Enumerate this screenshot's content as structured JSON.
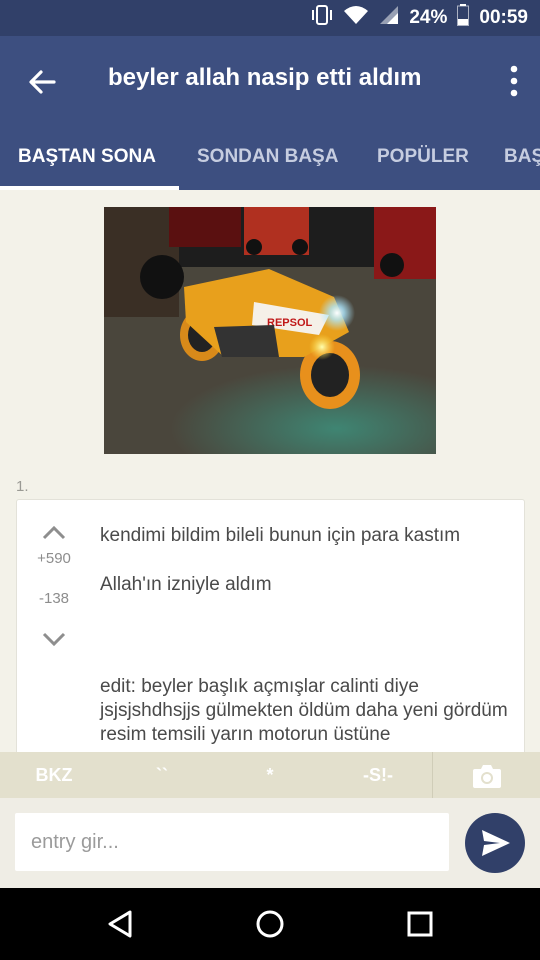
{
  "status_bar": {
    "battery": "24%",
    "time": "00:59",
    "icons": [
      "vibrate-icon",
      "wifi-icon",
      "signal-icon",
      "battery-icon"
    ]
  },
  "header": {
    "title": "beyler allah nasip etti aldım",
    "back_icon": "arrow-back-icon",
    "more_icon": "more-vert-icon"
  },
  "tabs": [
    {
      "label": "BAŞTAN SONA",
      "active": true
    },
    {
      "label": "SONDAN BAŞA",
      "active": false
    },
    {
      "label": "POPÜLER",
      "active": false
    },
    {
      "label": "BAŞ",
      "active": false
    }
  ],
  "entry": {
    "number": "1.",
    "upvotes": "+590",
    "downvotes": "-138",
    "paragraphs": [
      "kendimi bildim bileli bunun için para kastım",
      "Allah'ın izniyle aldım",
      "edit: beyler başlık açmışlar calinti diye jsjsjshdhsjjs gülmekten öldüm daha yeni gördüm resim temsili yarın motorun üstüne"
    ]
  },
  "toolbar": {
    "bkz": "BKZ",
    "quote": "``",
    "star": "*",
    "spoiler": "-S!-",
    "camera_icon": "camera-icon"
  },
  "composer": {
    "placeholder": "entry gir...",
    "send_icon": "send-icon"
  },
  "colors": {
    "primary": "#3d4f80",
    "status_bar": "#314069",
    "background": "#f3f2e9",
    "toolbar": "#e3e0cd"
  }
}
